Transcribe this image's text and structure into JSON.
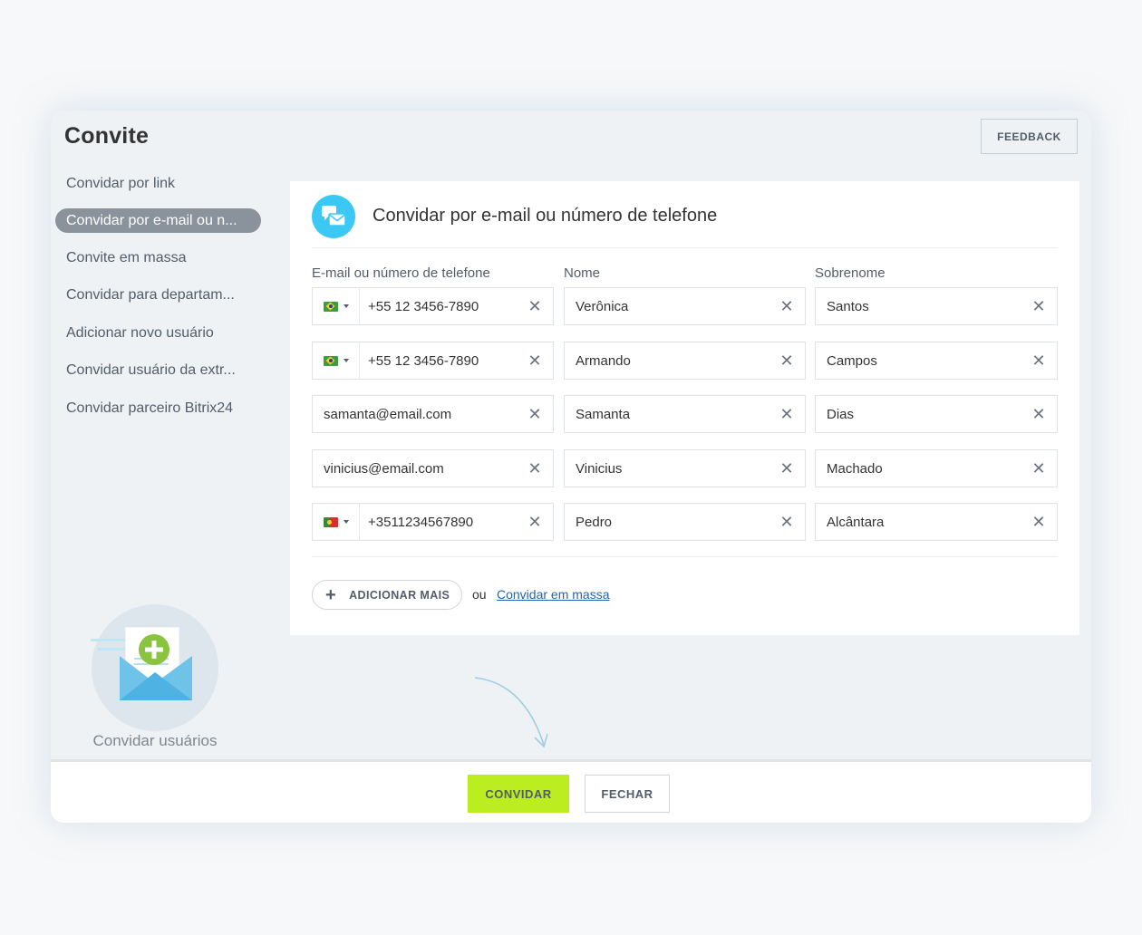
{
  "dialog": {
    "title": "Convite",
    "feedback_label": "FEEDBACK"
  },
  "sidebar": {
    "items": [
      {
        "label": "Convidar por link"
      },
      {
        "label": "Convidar por e-mail ou n..."
      },
      {
        "label": "Convite em massa"
      },
      {
        "label": "Convidar para departam..."
      },
      {
        "label": "Adicionar novo usuário"
      },
      {
        "label": "Convidar usuário da extr..."
      },
      {
        "label": "Convidar parceiro Bitrix24"
      }
    ],
    "active_index": 1,
    "illustration_label": "Convidar usuários"
  },
  "panel": {
    "title": "Convidar por e-mail ou número de telefone",
    "headers": {
      "contact": "E-mail ou número de telefone",
      "first_name": "Nome",
      "last_name": "Sobrenome"
    },
    "rows": [
      {
        "contact": "+55 12 3456-7890",
        "flag": "brazil-flag-icon",
        "first_name": "Verônica",
        "last_name": "Santos"
      },
      {
        "contact": "+55 12 3456-7890",
        "flag": "brazil-flag-icon",
        "first_name": "Armando",
        "last_name": "Campos"
      },
      {
        "contact": "samanta@email.com",
        "flag": "",
        "first_name": "Samanta",
        "last_name": "Dias"
      },
      {
        "contact": "vinicius@email.com",
        "flag": "",
        "first_name": "Vinicius",
        "last_name": "Machado"
      },
      {
        "contact": "+3511234567890",
        "flag": "portugal-flag-icon",
        "first_name": "Pedro",
        "last_name": "Alcântara"
      }
    ],
    "clear_glyph": "✕",
    "add_more_label": "ADICIONAR MAIS",
    "or_label": "ou",
    "mass_invite_link": "Convidar em massa"
  },
  "footer": {
    "invite_label": "CONVIDAR",
    "close_label": "FECHAR"
  },
  "colors": {
    "accent_green": "#bbed21",
    "accent_blue": "#3bc8f5",
    "link": "#2067b0"
  }
}
